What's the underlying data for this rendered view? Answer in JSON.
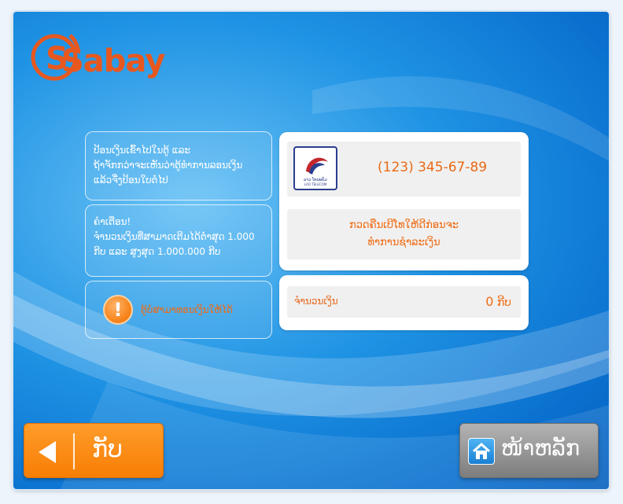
{
  "brand": {
    "name": "Sabay",
    "color": "#e7581f"
  },
  "info": {
    "instruction_lines": [
      "ປ້ອນເງິນເຂົ້າໄປໃນຕູ້ ແລະ",
      "ຖ້າຈັກກວ່າຈະເຫັນວ່າຕູ້ທຳການລອນເງິນ",
      "ແລ້ວຈື່ງປ້ອນໃບຕໍ່ໄປ"
    ],
    "warning_lines": [
      "ຄຳເຕືອນ!",
      "ຈຳນວນເງິນທີ່ສາມາດເຕີມໄດ້ຕ່ຳສຸດ 1.000",
      "ກີບ ແລະ ສູງສຸດ 1.000.000 ກີບ"
    ],
    "alert_text": "ຕູ້ບໍ່ສາມາທອນເງິນໃຫ້ໄດ້",
    "alert_icon": "exclamation-icon"
  },
  "payment": {
    "operator_logo": "lao-telecom-logo",
    "operator_name": "ລາວ ໂທລະຄົມ",
    "operator_name_en": "LAO TELECOM",
    "phone_number": "(123) 345-67-89",
    "message_lines": [
      "ກວດຄືນເບີໂທໃຫ້ດີກ່ອນຈະ",
      "ທຳການຊຳລະເງິນ"
    ],
    "amount_label": "ຈຳນວນເງິນ",
    "amount_value": "0",
    "amount_unit": "ກີບ"
  },
  "buttons": {
    "back_label": "ກັບ",
    "home_label": "ໜ້າຫລັກ"
  },
  "colors": {
    "accent": "#ef6b12",
    "back_button": "#f77e05",
    "home_button": "#8a8a8a"
  }
}
